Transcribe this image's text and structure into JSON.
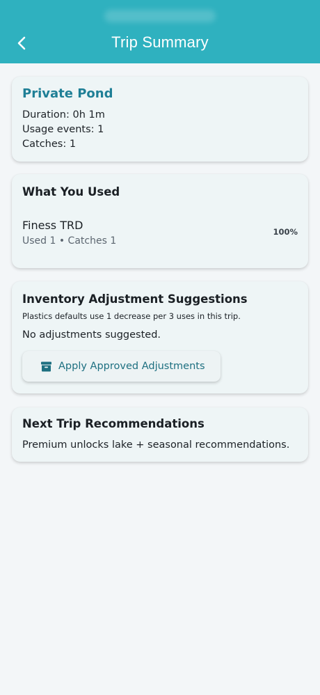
{
  "appbar": {
    "title": "Trip Summary",
    "back_icon": "chevron-left-icon",
    "background": "#2fb1bf"
  },
  "trip": {
    "location": "Private Pond",
    "duration": "Duration: 0h 1m",
    "usage_events": "Usage events: 1",
    "catches": "Catches: 1"
  },
  "used": {
    "title": "What You Used",
    "items": [
      {
        "name": "Finess TRD",
        "detail": "Used 1 • Catches 1",
        "percent": "100%"
      }
    ]
  },
  "inventory": {
    "title": "Inventory Adjustment Suggestions",
    "note": "Plastics defaults use 1 decrease per 3 uses in this trip.",
    "status": "No adjustments suggested.",
    "apply_label": "Apply Approved Adjustments",
    "apply_icon": "archive-box-icon"
  },
  "recommendations": {
    "title": "Next Trip Recommendations",
    "text": "Premium unlocks lake + seasonal recommendations."
  },
  "colors": {
    "accent": "#1f7f96",
    "button_text": "#1d6f80",
    "card_bg": "#eef5f6",
    "page_bg": "#f3f6f8"
  }
}
